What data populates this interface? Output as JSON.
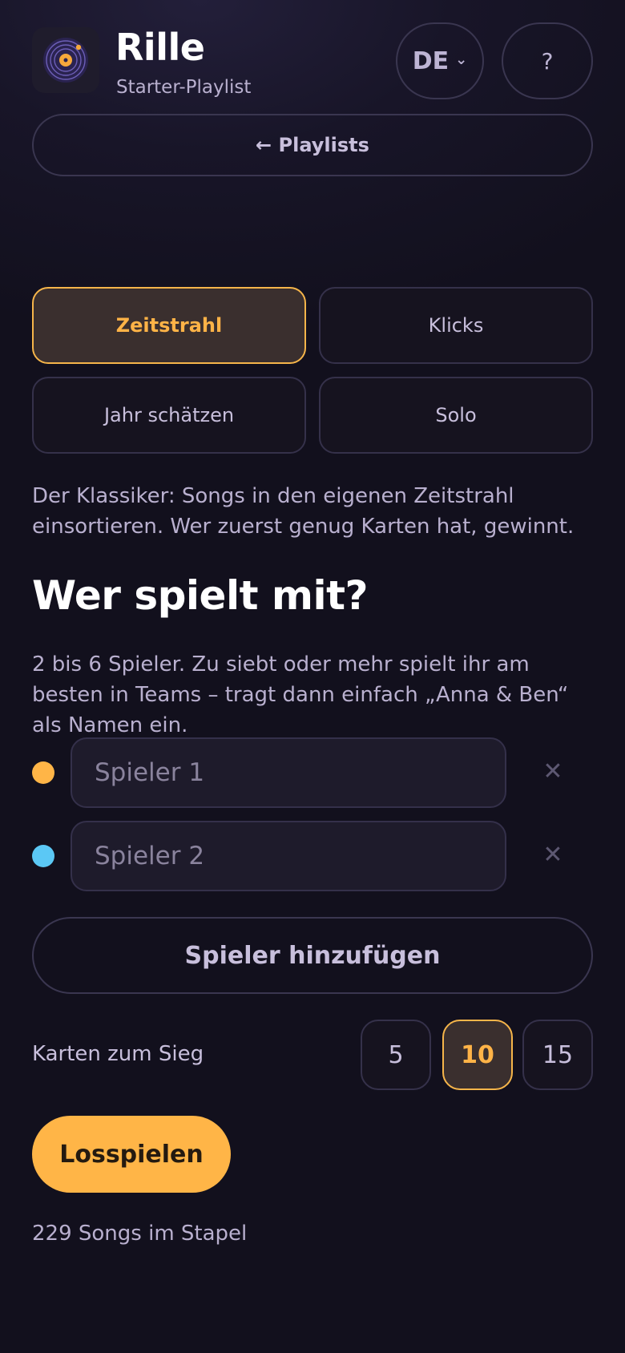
{
  "header": {
    "title": "Rille",
    "subtitle": "Starter-Playlist",
    "language": "DE",
    "help_label": "?"
  },
  "back_label": "← Playlists",
  "modes": [
    {
      "label": "Zeitstrahl",
      "active": true
    },
    {
      "label": "Klicks",
      "active": false
    },
    {
      "label": "Jahr schätzen",
      "active": false
    },
    {
      "label": "Solo",
      "active": false
    }
  ],
  "mode_description": "Der Klassiker: Songs in den eigenen Zeitstrahl einsortieren. Wer zuerst genug Karten hat, gewinnt.",
  "players_heading": "Wer spielt mit?",
  "players_hint": "2 bis 6 Spieler. Zu siebt oder mehr spielt ihr am besten in Teams – tragt dann einfach „Anna & Ben“ als Namen ein.",
  "players": [
    {
      "placeholder": "Spieler 1",
      "value": "",
      "color": "#ffb547"
    },
    {
      "placeholder": "Spieler 2",
      "value": "",
      "color": "#5bc8f5"
    }
  ],
  "remove_symbol": "✕",
  "add_player_label": "Spieler hinzufügen",
  "cards_to_win": {
    "label": "Karten zum Sieg",
    "options": [
      "5",
      "10",
      "15"
    ],
    "selected": "10"
  },
  "start_label": "Losspielen",
  "deck_info": "229 Songs im Stapel",
  "colors": {
    "accent": "#ffb547",
    "background": "#12101d"
  },
  "icons": {
    "logo": "vinyl-record-icon",
    "lang_chevron": "chevron-down-icon",
    "remove": "close-icon"
  }
}
